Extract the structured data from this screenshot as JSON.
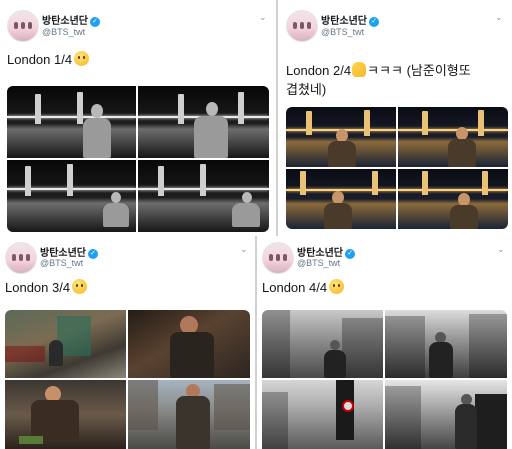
{
  "tweets": [
    {
      "display_name": "방탄소년단",
      "verified_mark": "✓",
      "handle": "@BTS_twt",
      "text": "London 1/4",
      "emoji_icon": "smiling-face-emoji",
      "menu_icon": "chevron-down-icon",
      "photos": [
        "black-and-white photo at Tower Bridge",
        "black-and-white photo at Tower Bridge",
        "black-and-white photo at Tower Bridge",
        "black-and-white photo at Tower Bridge"
      ]
    },
    {
      "display_name": "방탄소년단",
      "verified_mark": "✓",
      "handle": "@BTS_twt",
      "text_a": "London 2/4",
      "text_b": "ㅋㅋㅋ (남준이형또",
      "text_c": "겹쳤네)",
      "emoji_icon": "waving-hand-emoji",
      "menu_icon": "chevron-down-icon",
      "photos": [
        "color night photo at Tower Bridge",
        "color night photo at Tower Bridge",
        "color night photo at Tower Bridge",
        "color night photo at Tower Bridge"
      ]
    },
    {
      "display_name": "방탄소년단",
      "verified_mark": "✓",
      "handle": "@BTS_twt",
      "text": "London 3/4",
      "emoji_icon": "relieved-face-emoji",
      "menu_icon": "chevron-down-icon",
      "photos": [
        "street photo",
        "cafe photo",
        "restaurant photo",
        "street photo"
      ]
    },
    {
      "display_name": "방탄소년단",
      "verified_mark": "✓",
      "handle": "@BTS_twt",
      "text": "London 4/4",
      "emoji_icon": "winking-tongue-emoji",
      "menu_icon": "chevron-down-icon",
      "photos": [
        "black-and-white street photo",
        "black-and-white street photo",
        "black-and-white street photo",
        "black-and-white street photo"
      ]
    }
  ],
  "colors": {
    "verified": "#1da1f2",
    "name": "#14171a",
    "handle": "#657786"
  }
}
